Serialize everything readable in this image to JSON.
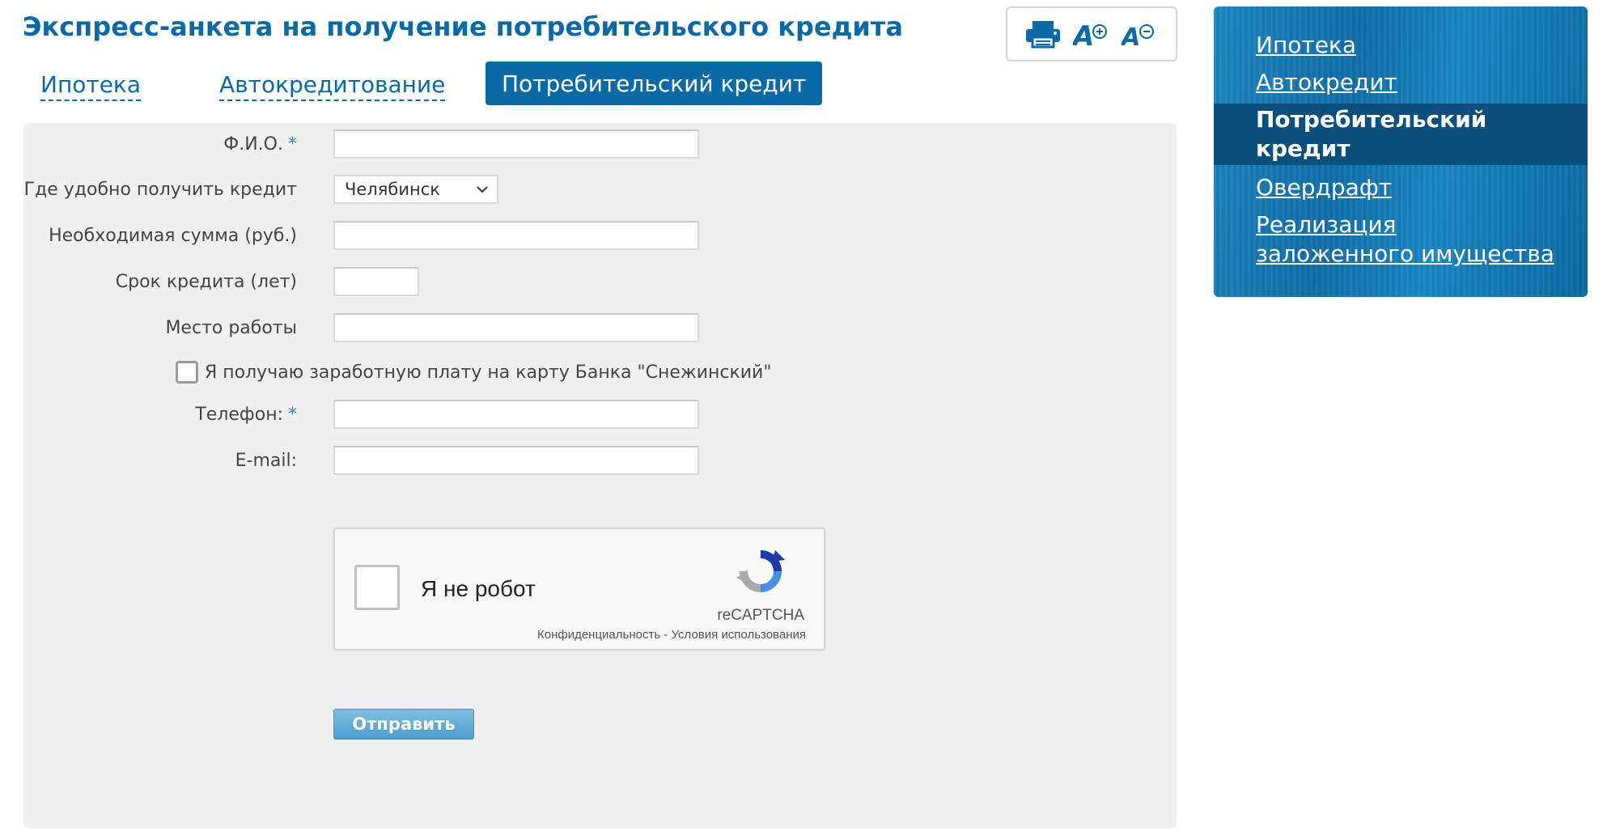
{
  "page": {
    "title": "Экспресс-анкета на получение потребительского кредита"
  },
  "toolbar": {
    "print_icon": "printer-icon",
    "font_increase_icon": "font-increase-icon",
    "font_decrease_icon": "font-decrease-icon"
  },
  "tabs": {
    "items": [
      "Ипотека",
      "Автокредитование",
      "Потребительский кредит"
    ],
    "active": "Потребительский кредит"
  },
  "form": {
    "fio": {
      "label": "Ф.И.О.",
      "required_mark": "*",
      "value": ""
    },
    "city": {
      "label": "Где удобно получить кредит",
      "value": "Челябинск"
    },
    "amount": {
      "label": "Необходимая сумма (руб.)",
      "value": ""
    },
    "term": {
      "label": "Срок кредита (лет)",
      "value": ""
    },
    "workplace": {
      "label": "Место работы",
      "value": ""
    },
    "salary_card": {
      "label": "Я получаю заработную плату на карту Банка \"Снежинский\"",
      "checked": false
    },
    "phone": {
      "label": "Телефон:",
      "required_mark": "*",
      "value": ""
    },
    "email": {
      "label": "E-mail:",
      "value": ""
    },
    "submit_label": "Отправить"
  },
  "recaptcha": {
    "checkbox_label": "Я не робот",
    "brand": "reCAPTCHA",
    "privacy": "Конфиденциальность",
    "separator": " - ",
    "terms": "Условия использования"
  },
  "side_nav": {
    "items": [
      "Ипотека",
      "Автокредит",
      "Потребительский кредит",
      "Овердрафт",
      "Реализация заложенного имущества"
    ],
    "active": "Потребительский кредит"
  },
  "colors": {
    "brand_blue": "#0a6aa6",
    "panel_bg": "#f0f0f0",
    "required_star": "#2a8bd1"
  }
}
